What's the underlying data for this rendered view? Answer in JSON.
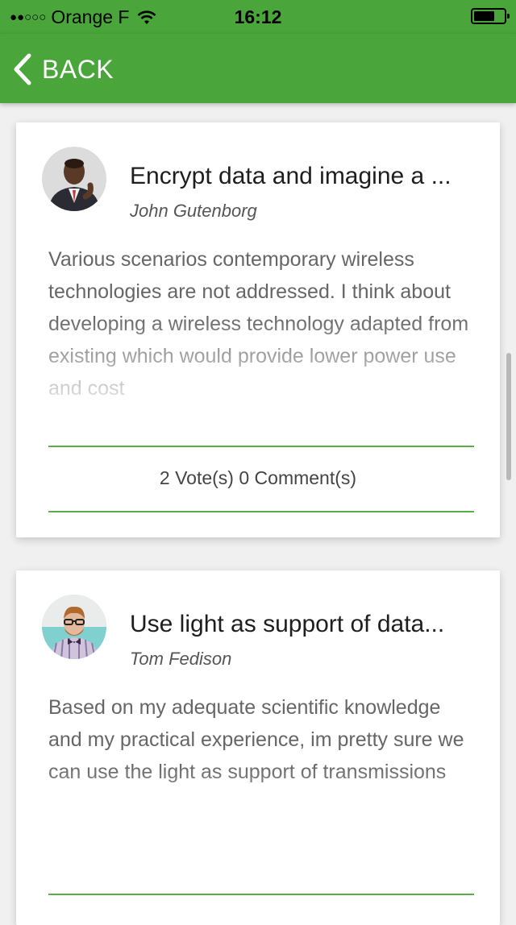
{
  "status_bar": {
    "signal": "●●○○○",
    "carrier": "Orange F",
    "time": "16:12",
    "battery_level": 0.7
  },
  "nav": {
    "back_label": "BACK"
  },
  "ideas": [
    {
      "title": "Encrypt data and imagine a ...",
      "author": "John Gutenborg",
      "description": "Various scenarios contemporary wireless technologies are not addressed. I think about developing a wireless technology adapted from existing which would provide lower power use and cost",
      "stats": "2 Vote(s) 0 Comment(s)"
    },
    {
      "title": "Use light as support of data...",
      "author": "Tom Fedison",
      "description": "Based on my adequate scientific knowledge and my practical experience, im pretty sure we can use the light as support of transmissions"
    }
  ],
  "colors": {
    "brand_green": "#4aa53a",
    "divider_green": "#5bad4a"
  },
  "icons": {
    "back": "chevron-left-icon",
    "wifi": "wifi-icon",
    "battery": "battery-icon"
  }
}
